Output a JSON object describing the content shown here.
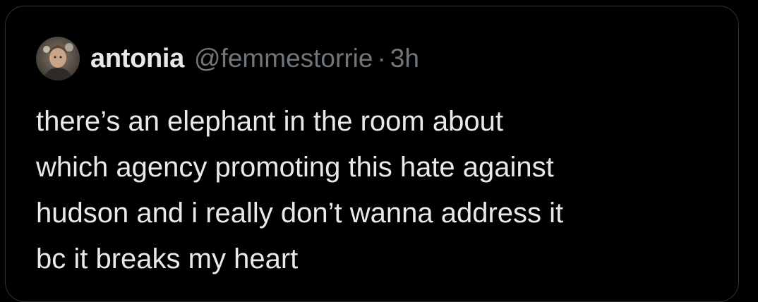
{
  "tweet": {
    "display_name": "antonia",
    "handle": "@femmestorrie",
    "separator": "·",
    "time": "3h",
    "text_lines": [
      "there’s an elephant in the room about",
      "which agency promoting this hate against",
      "hudson and i really don’t wanna address it",
      "bc it breaks my heart"
    ]
  },
  "colors": {
    "background": "#000000",
    "primary_text": "#e7e9ea",
    "secondary_text": "#71767b",
    "border": "#2f3336"
  },
  "icons": {
    "avatar": "profile-photo"
  }
}
